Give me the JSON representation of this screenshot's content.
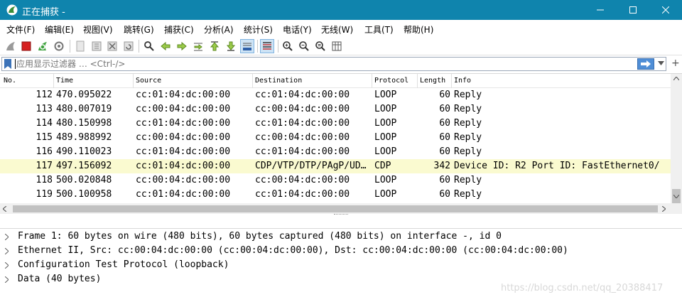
{
  "window": {
    "title": "正在捕获 -",
    "minimize_icon": "minimize-icon",
    "maximize_icon": "maximize-icon",
    "close_icon": "close-icon",
    "titlebar_color": "#0f84ad"
  },
  "menu": [
    "文件(F)",
    "编辑(E)",
    "视图(V)",
    "跳转(G)",
    "捕获(C)",
    "分析(A)",
    "统计(S)",
    "电话(Y)",
    "无线(W)",
    "工具(T)",
    "帮助(H)"
  ],
  "toolbar": {
    "icons": [
      "shark-fin-start-icon",
      "stop-capture-icon",
      "restart-capture-icon",
      "capture-options-icon",
      "open-file-icon",
      "save-file-icon",
      "close-file-icon",
      "reload-file-icon",
      "find-packet-icon",
      "go-back-icon",
      "go-forward-icon",
      "go-to-packet-icon",
      "go-first-icon",
      "go-last-icon",
      "auto-scroll-icon",
      "colorize-icon",
      "zoom-in-icon",
      "zoom-out-icon",
      "zoom-normal-icon",
      "resize-columns-icon"
    ]
  },
  "filter": {
    "placeholder": "应用显示过滤器 … <Ctrl-/>",
    "apply_icon": "arrow-right-icon",
    "bookmark_icon": "bookmark-icon",
    "dropdown_icon": "chevron-down-icon",
    "add_label": "+"
  },
  "packet_list": {
    "columns": [
      "No.",
      "Time",
      "Source",
      "Destination",
      "Protocol",
      "Length",
      "Info"
    ],
    "rows": [
      {
        "no": "112",
        "time": "470.095022",
        "src": "cc:01:04:dc:00:00",
        "dst": "cc:01:04:dc:00:00",
        "proto": "LOOP",
        "len": "60",
        "info": "Reply",
        "highlight": false
      },
      {
        "no": "113",
        "time": "480.007019",
        "src": "cc:00:04:dc:00:00",
        "dst": "cc:00:04:dc:00:00",
        "proto": "LOOP",
        "len": "60",
        "info": "Reply",
        "highlight": false
      },
      {
        "no": "114",
        "time": "480.150998",
        "src": "cc:01:04:dc:00:00",
        "dst": "cc:01:04:dc:00:00",
        "proto": "LOOP",
        "len": "60",
        "info": "Reply",
        "highlight": false
      },
      {
        "no": "115",
        "time": "489.988992",
        "src": "cc:00:04:dc:00:00",
        "dst": "cc:00:04:dc:00:00",
        "proto": "LOOP",
        "len": "60",
        "info": "Reply",
        "highlight": false
      },
      {
        "no": "116",
        "time": "490.110023",
        "src": "cc:01:04:dc:00:00",
        "dst": "cc:01:04:dc:00:00",
        "proto": "LOOP",
        "len": "60",
        "info": "Reply",
        "highlight": false
      },
      {
        "no": "117",
        "time": "497.156092",
        "src": "cc:01:04:dc:00:00",
        "dst": "CDP/VTP/DTP/PAgP/UD…",
        "proto": "CDP",
        "len": "342",
        "info": "Device ID: R2  Port ID: FastEthernet0/",
        "highlight": true
      },
      {
        "no": "118",
        "time": "500.020848",
        "src": "cc:00:04:dc:00:00",
        "dst": "cc:00:04:dc:00:00",
        "proto": "LOOP",
        "len": "60",
        "info": "Reply",
        "highlight": false
      },
      {
        "no": "119",
        "time": "500.100958",
        "src": "cc:01:04:dc:00:00",
        "dst": "cc:01:04:dc:00:00",
        "proto": "LOOP",
        "len": "60",
        "info": "Reply",
        "highlight": false
      }
    ],
    "highlight_color": "#fafad0"
  },
  "details": [
    "Frame 1: 60 bytes on wire (480 bits), 60 bytes captured (480 bits) on interface -, id 0",
    "Ethernet II, Src: cc:00:04:dc:00:00 (cc:00:04:dc:00:00), Dst: cc:00:04:dc:00:00 (cc:00:04:dc:00:00)",
    "Configuration Test Protocol (loopback)",
    "Data (40 bytes)"
  ],
  "watermark": "https://blog.csdn.net/qq_20388417"
}
